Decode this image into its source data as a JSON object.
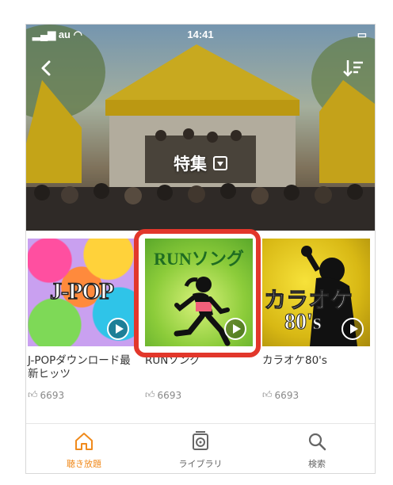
{
  "status_bar": {
    "carrier": "au",
    "time": "14:41"
  },
  "hero": {
    "title": "特集"
  },
  "cards": [
    {
      "title": "J-POPダウンロード最新ヒッツ",
      "likes": "6693",
      "art_text": "J-POP"
    },
    {
      "title": "RUNソング",
      "likes": "6693",
      "art_text": "RUNソング"
    },
    {
      "title": "カラオケ80's",
      "likes": "6693",
      "art_text": "カラオケ",
      "art_sub": "80's"
    }
  ],
  "tabs": [
    {
      "label": "聴き放題",
      "icon": "home-icon",
      "active": true
    },
    {
      "label": "ライブラリ",
      "icon": "library-icon",
      "active": false
    },
    {
      "label": "検索",
      "icon": "search-icon",
      "active": false
    }
  ],
  "colors": {
    "accent": "#f08a1c",
    "highlight": "#e2372b",
    "inactive_tab": "#666666"
  }
}
